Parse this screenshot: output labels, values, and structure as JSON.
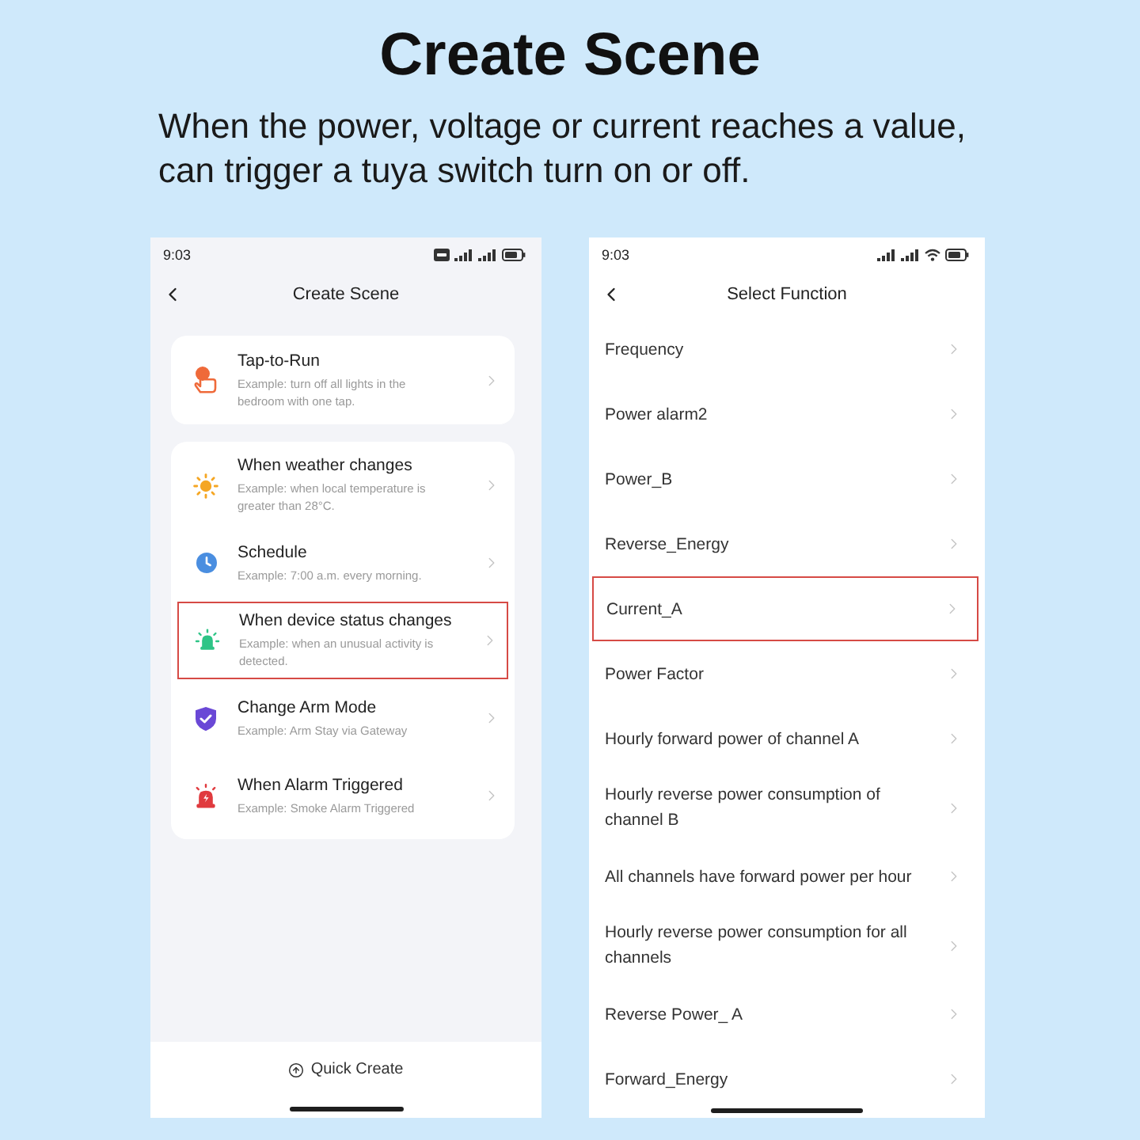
{
  "heading": {
    "title": "Create Scene",
    "description_lines": [
      "When the power, voltage or current reaches a value,",
      "can trigger a tuya switch turn on or off."
    ]
  },
  "phones": [
    {
      "kind": "scene_menu",
      "status_bar": {
        "time": "9:03"
      },
      "header": {
        "title": "Create Scene"
      },
      "cards": [
        {
          "items": [
            {
              "kind": "tap",
              "title": "Tap-to-Run",
              "example": "Example: turn off all lights in the bedroom with one tap.",
              "selected": false
            }
          ]
        },
        {
          "items": [
            {
              "kind": "weather",
              "title": "When weather changes",
              "example": "Example: when local temperature is greater than 28°C.",
              "selected": false
            },
            {
              "kind": "schedule",
              "title": "Schedule",
              "example": "Example: 7:00 a.m. every morning.",
              "selected": false
            },
            {
              "kind": "device",
              "title": "When device status changes",
              "example": "Example: when an unusual activity is detected.",
              "selected": true
            },
            {
              "kind": "arm",
              "title": "Change Arm Mode",
              "example": "Example: Arm Stay via Gateway",
              "selected": false
            },
            {
              "kind": "alarm",
              "title": "When Alarm Triggered",
              "example": "Example: Smoke Alarm Triggered",
              "selected": false
            }
          ]
        }
      ],
      "footer": {
        "button": "Quick Create"
      }
    },
    {
      "kind": "function_list",
      "status_bar": {
        "time": "9:03"
      },
      "header": {
        "title": "Select Function"
      },
      "items": [
        {
          "label": "Frequency",
          "selected": false
        },
        {
          "label": "Power alarm2",
          "selected": false
        },
        {
          "label": "Power_B",
          "selected": false
        },
        {
          "label": "Reverse_Energy",
          "selected": false
        },
        {
          "label": "Current_A",
          "selected": true
        },
        {
          "label": "Power Factor",
          "selected": false
        },
        {
          "label": "Hourly forward power of channel A",
          "selected": false
        },
        {
          "label": "Hourly reverse power consumption of channel B",
          "selected": false
        },
        {
          "label": "All channels have forward power per hour",
          "selected": false
        },
        {
          "label": "Hourly reverse power consumption for all channels",
          "selected": false
        },
        {
          "label": "Reverse Power_ A",
          "selected": false
        },
        {
          "label": "Forward_Energy",
          "selected": false
        }
      ]
    }
  ]
}
